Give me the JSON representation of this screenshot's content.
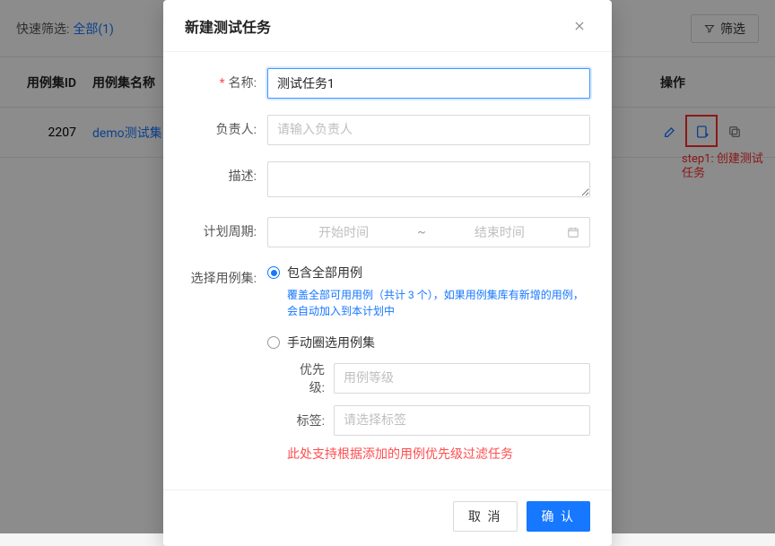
{
  "background": {
    "quick_filter_label": "快速筛选:",
    "quick_filter_link": "全部(1)",
    "filter_button": "筛选",
    "table": {
      "headers": {
        "id": "用例集ID",
        "name": "用例集名称",
        "action": "操作"
      },
      "row": {
        "id": "2207",
        "name": "demo测试集"
      }
    },
    "annotation_step1": "step1: 创建测试任务"
  },
  "modal": {
    "title": "新建测试任务",
    "labels": {
      "name": "名称:",
      "owner": "负责人:",
      "desc": "描述:",
      "period": "计划周期:",
      "case_set": "选择用例集:",
      "priority": "优先级:",
      "tags": "标签:"
    },
    "name_value": "测试任务1",
    "owner_placeholder": "请输入负责人",
    "period_start_placeholder": "开始时间",
    "period_end_placeholder": "结束时间",
    "radio_all_label": "包含全部用例",
    "radio_all_desc": "覆盖全部可用用例（共计 3 个），如果用例集库有新增的用例，会自动加入到本计划中",
    "radio_manual_label": "手动圈选用例集",
    "priority_placeholder": "用例等级",
    "tags_placeholder": "请选择标签",
    "note_red": "此处支持根据添加的用例优先级过滤任务",
    "cancel": "取 消",
    "ok": "确 认"
  }
}
